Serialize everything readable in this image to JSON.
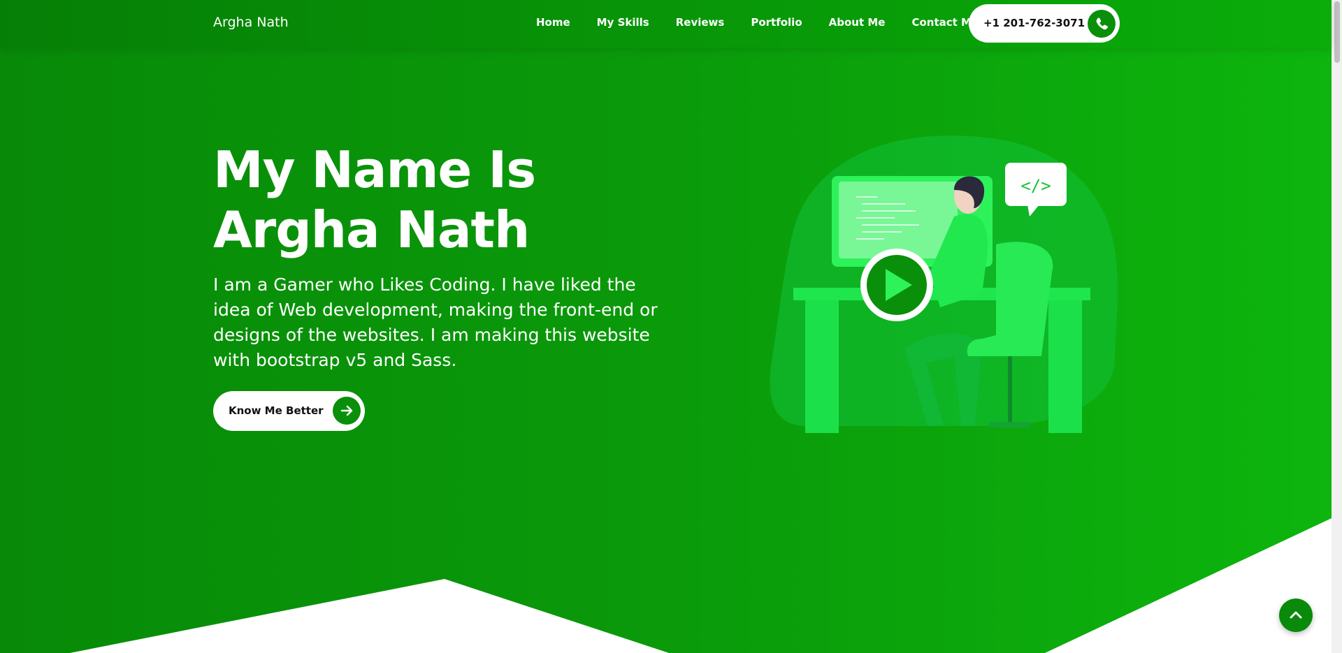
{
  "brand": "Argha Nath",
  "nav": {
    "items": [
      {
        "label": "Home"
      },
      {
        "label": "My Skills"
      },
      {
        "label": "Reviews"
      },
      {
        "label": "Portfolio"
      },
      {
        "label": "About Me"
      },
      {
        "label": "Contact Me"
      }
    ],
    "phone": "+1 201-762-3071",
    "phone_icon": "phone-icon"
  },
  "hero": {
    "title_line1": "My Name Is",
    "title_line2": "Argha Nath",
    "description": "I am a Gamer who Likes Coding. I have liked the idea of Web development, making the front-end or designs of the websites. I am making this website with bootstrap v5 and Sass.",
    "button_label": "Know Me Better",
    "button_icon": "arrow-right-icon",
    "code_bubble": "</>"
  },
  "scroll_top_icon": "chevron-up-icon",
  "colors": {
    "primary": "#0a8f0a",
    "hero_start": "#088a08",
    "hero_end": "#0db50d",
    "accent_light": "#22e04a",
    "white": "#ffffff"
  }
}
